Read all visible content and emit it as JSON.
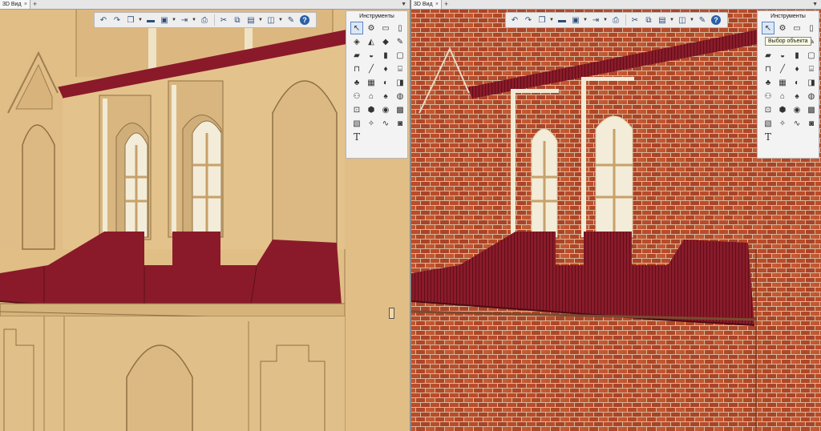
{
  "left": {
    "tab": {
      "title": "3D Вид",
      "close": "×",
      "add": "+"
    },
    "palette_title": "Инструменты"
  },
  "right": {
    "tab": {
      "title": "3D Вид",
      "close": "×",
      "add": "+"
    },
    "palette_title": "Инструменты",
    "tooltip": "Выбор объекта"
  },
  "toolbar_icons": [
    "undo-icon",
    "redo-icon",
    "model-icon",
    "folder-icon",
    "save-icon",
    "export-icon",
    "print-icon",
    "cut-icon",
    "copy-icon",
    "paste-icon",
    "layers-icon",
    "wrench-icon",
    "help-icon"
  ],
  "help_label": "?",
  "text_tool_label": "T",
  "colors": {
    "roof": "#8a1a2a",
    "wall_plain": "#e2c18a",
    "wall_brick": "#b24a2c",
    "mortar": "#d8b79a",
    "toolbar_bg": "#eeeeee",
    "accent": "#2b5fa8"
  }
}
